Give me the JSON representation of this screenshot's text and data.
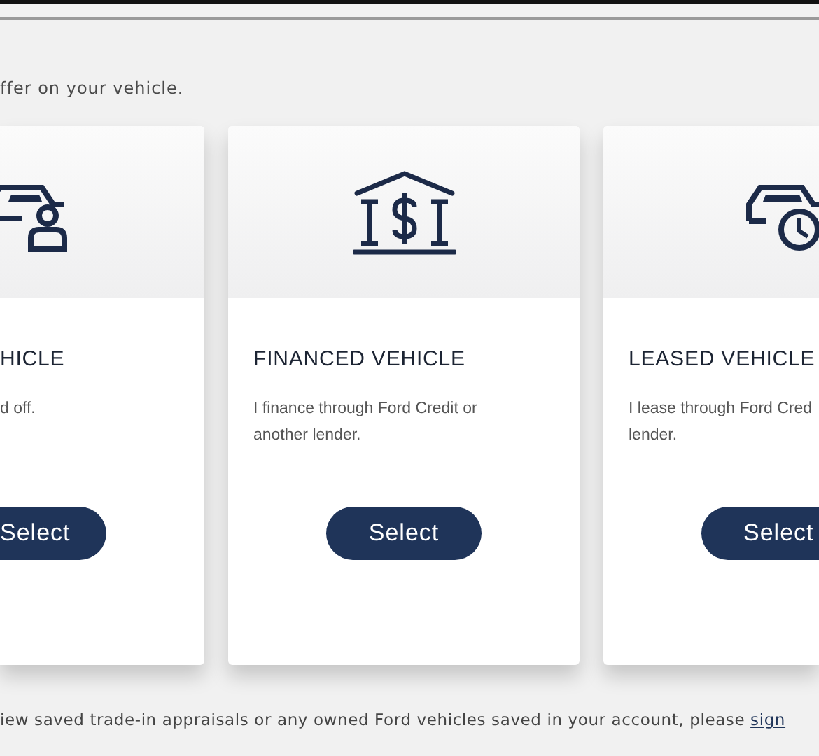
{
  "intro": "ffer on your vehicle.",
  "cards": [
    {
      "title": "HICLE",
      "description_lines": [
        "d off."
      ],
      "button": "Select"
    },
    {
      "title": "FINANCED VEHICLE",
      "description_lines": [
        "I finance through Ford Credit or",
        "another lender."
      ],
      "button": "Select"
    },
    {
      "title": "LEASED VEHICLE",
      "description_lines": [
        "I lease through Ford Cred",
        "lender."
      ],
      "button": "Select"
    }
  ],
  "footer": {
    "text": "iew saved trade-in appraisals or any owned Ford vehicles saved in your account, please ",
    "link": "sign"
  }
}
